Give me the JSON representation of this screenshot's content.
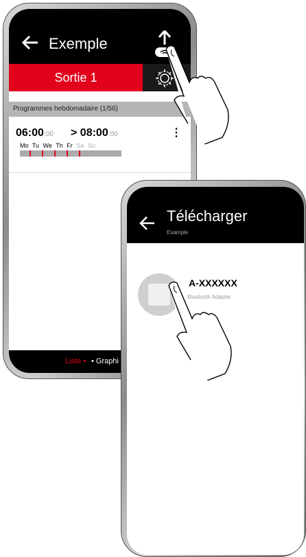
{
  "phone1": {
    "title": "Exemple",
    "output_tab": "Sortie 1",
    "section_header": "Programmes hebdomadaire (1/56)",
    "program": {
      "start_time": "06:00",
      "start_seconds": ":00",
      "end_prefix": "> ",
      "end_time": "08:00",
      "end_seconds": ":00",
      "menu": "⋮",
      "days_active": [
        "Mo",
        "Tu",
        "We",
        "Th",
        "Fr"
      ],
      "days_inactive": [
        "Sa",
        "Su"
      ]
    },
    "bottom": {
      "liste": "Liste • ",
      "graph": "• Graphi"
    }
  },
  "phone2": {
    "title": "Télécharger",
    "subtitle": "Example",
    "device": {
      "name": "A-XXXXXX",
      "type": "Bluetooth Adapter"
    }
  },
  "colors": {
    "accent": "#e2001a",
    "bar": "#000000"
  }
}
